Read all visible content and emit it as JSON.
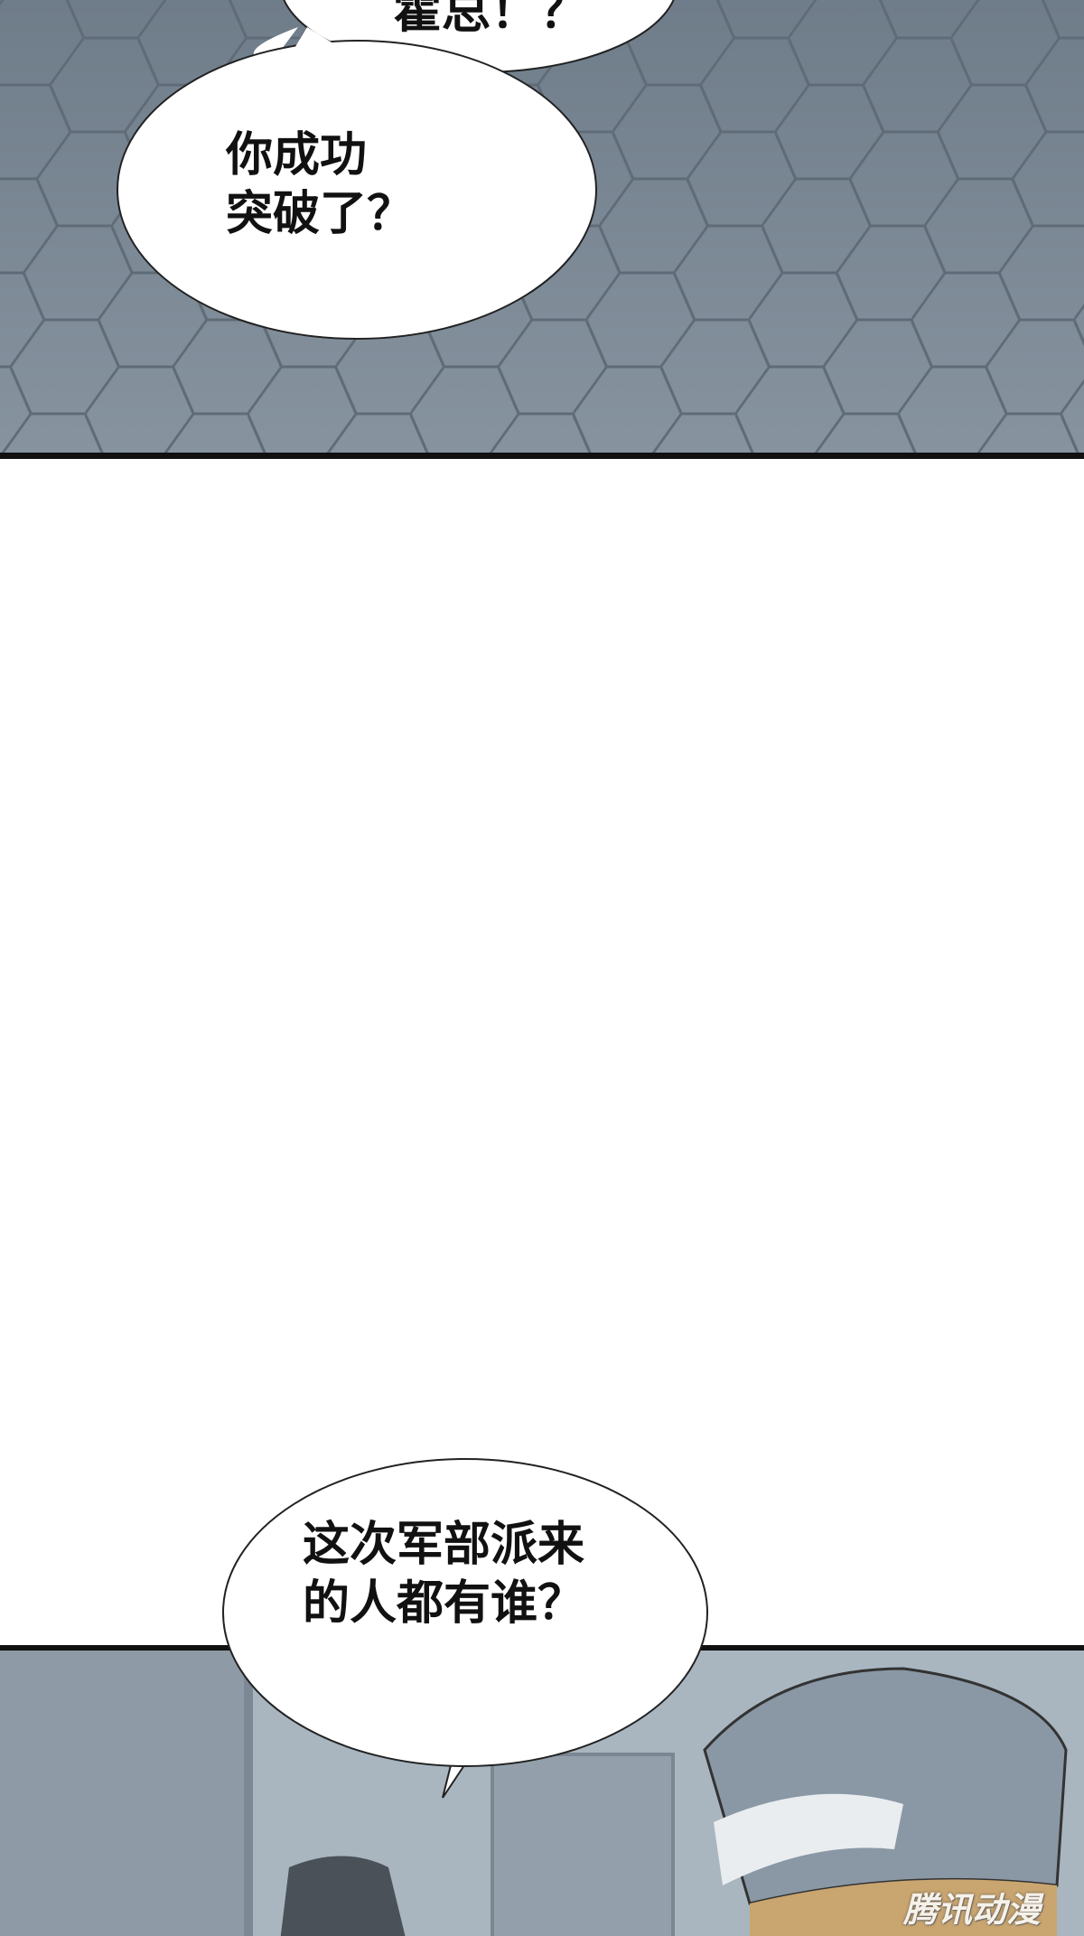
{
  "bubbles": [
    {
      "text": "霍总！？"
    },
    {
      "text": "你成功\n突破了？"
    },
    {
      "text": "这次军部派来\n的人都有谁？"
    }
  ],
  "watermark": "腾讯动漫",
  "colors": {
    "floor": "#7d8a97",
    "hex_lines": "#5f6b77",
    "bubble_fill": "#ffffff",
    "bubble_stroke": "#222222",
    "wall": "#a9b6c0",
    "hat": "#8a98a5",
    "panel_border": "#111111"
  }
}
